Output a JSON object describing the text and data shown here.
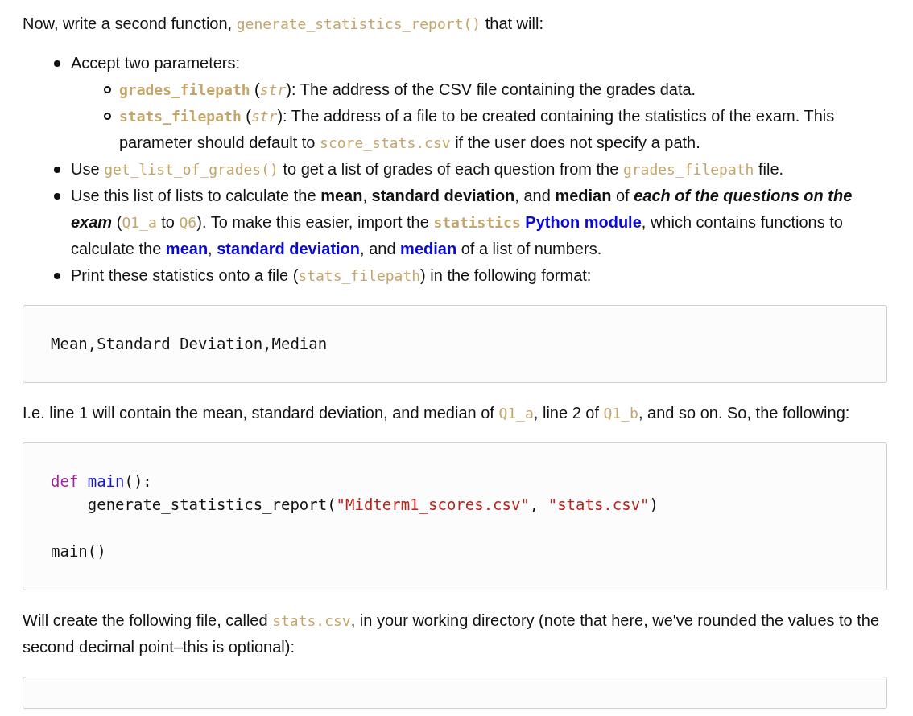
{
  "intro": [
    {
      "kind": "text",
      "text": "Now, write a second function, "
    },
    {
      "kind": "code",
      "text": "generate_statistics_report()"
    },
    {
      "kind": "text",
      "text": " that will:"
    }
  ],
  "bullets": [
    {
      "segments": [
        {
          "kind": "text",
          "text": "Accept two parameters:"
        }
      ],
      "children": [
        {
          "segments": [
            {
              "kind": "codebold",
              "text": "grades_filepath"
            },
            {
              "kind": "text",
              "text": " ("
            },
            {
              "kind": "codeitalic",
              "text": "str"
            },
            {
              "kind": "text",
              "text": "): The address of the CSV file containing the grades data."
            }
          ]
        },
        {
          "segments": [
            {
              "kind": "codebold",
              "text": "stats_filepath"
            },
            {
              "kind": "text",
              "text": " ("
            },
            {
              "kind": "codeitalic",
              "text": "str"
            },
            {
              "kind": "text",
              "text": "): The address of a file to be created containing the statistics of the exam. This parameter should default to "
            },
            {
              "kind": "code",
              "text": "score_stats.csv"
            },
            {
              "kind": "text",
              "text": " if the user does not specify a path."
            }
          ]
        }
      ]
    },
    {
      "segments": [
        {
          "kind": "text",
          "text": "Use "
        },
        {
          "kind": "code",
          "text": "get_list_of_grades()"
        },
        {
          "kind": "text",
          "text": " to get a list of grades of each question from the "
        },
        {
          "kind": "code",
          "text": "grades_filepath"
        },
        {
          "kind": "text",
          "text": " file."
        }
      ]
    },
    {
      "segments": [
        {
          "kind": "text",
          "text": "Use this list of lists to calculate the "
        },
        {
          "kind": "bold",
          "text": "mean"
        },
        {
          "kind": "text",
          "text": ", "
        },
        {
          "kind": "bold",
          "text": "standard deviation"
        },
        {
          "kind": "text",
          "text": ", and "
        },
        {
          "kind": "bold",
          "text": "median"
        },
        {
          "kind": "text",
          "text": " of "
        },
        {
          "kind": "bolditalic",
          "text": "each of the questions on the exam"
        },
        {
          "kind": "text",
          "text": " ("
        },
        {
          "kind": "code",
          "text": "Q1_a"
        },
        {
          "kind": "text",
          "text": " to "
        },
        {
          "kind": "code",
          "text": "Q6"
        },
        {
          "kind": "text",
          "text": "). To make this easier, import the "
        },
        {
          "kind": "codebold",
          "text": "statistics"
        },
        {
          "kind": "link",
          "text": "Python module",
          "space_before": true
        },
        {
          "kind": "text",
          "text": ", which contains functions to calculate the "
        },
        {
          "kind": "link",
          "text": "mean"
        },
        {
          "kind": "text",
          "text": ", "
        },
        {
          "kind": "link",
          "text": "standard deviation"
        },
        {
          "kind": "text",
          "text": ", and "
        },
        {
          "kind": "link",
          "text": "median"
        },
        {
          "kind": "text",
          "text": " of a list of numbers."
        }
      ]
    },
    {
      "segments": [
        {
          "kind": "text",
          "text": "Print these statistics onto a file ("
        },
        {
          "kind": "code",
          "text": "stats_filepath"
        },
        {
          "kind": "text",
          "text": ") in the following format:"
        }
      ]
    }
  ],
  "code_block_1": [
    [
      {
        "kind": "plain",
        "text": "Mean,Standard Deviation,Median"
      }
    ]
  ],
  "paragraph_2": [
    {
      "kind": "text",
      "text": "I.e. line 1 will contain the mean, standard deviation, and median of "
    },
    {
      "kind": "code",
      "text": "Q1_a"
    },
    {
      "kind": "text",
      "text": ", line 2 of "
    },
    {
      "kind": "code",
      "text": "Q1_b"
    },
    {
      "kind": "text",
      "text": ", and so on. So, the following:"
    }
  ],
  "code_block_2": [
    [
      {
        "kind": "keyword",
        "text": "def",
        "space_after": true
      },
      {
        "kind": "func",
        "text": "main"
      },
      {
        "kind": "plain",
        "text": "():"
      }
    ],
    [
      {
        "kind": "plain",
        "text": "    generate_statistics_report("
      },
      {
        "kind": "string",
        "text": "\"Midterm1_scores.csv\""
      },
      {
        "kind": "plain",
        "text": ", "
      },
      {
        "kind": "string",
        "text": "\"stats.csv\""
      },
      {
        "kind": "plain",
        "text": ")"
      }
    ],
    [
      {
        "kind": "plain",
        "text": "main()",
        "gap_before": true
      }
    ]
  ],
  "paragraph_3": [
    {
      "kind": "text",
      "text": "Will create the following file, called "
    },
    {
      "kind": "code",
      "text": "stats.csv"
    },
    {
      "kind": "text",
      "text": ", in your working directory (note that here, we've rounded the values to the second decimal point–this is optional):"
    }
  ]
}
